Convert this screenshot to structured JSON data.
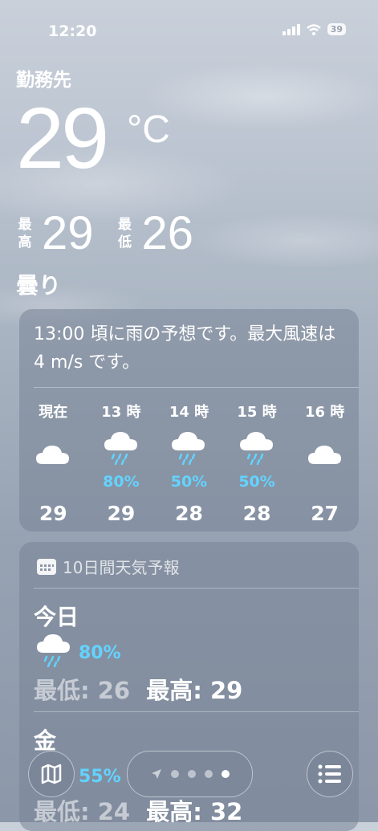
{
  "status": {
    "time": "12:20",
    "battery": "39"
  },
  "current": {
    "location": "勤務先",
    "temperature": "29",
    "unit": "°C",
    "high_label": "最高",
    "high": "29",
    "low_label": "最低",
    "low": "26",
    "condition": "曇り"
  },
  "hourly": {
    "summary": "13:00 頃に雨の予想です。最大風速は 4 m/s です。",
    "items": [
      {
        "label": "現在",
        "icon": "cloud-icon",
        "pop": "",
        "temp": "29"
      },
      {
        "label": "13 時",
        "icon": "rain-cloud-icon",
        "pop": "80%",
        "temp": "29"
      },
      {
        "label": "14 時",
        "icon": "rain-cloud-icon",
        "pop": "50%",
        "temp": "28"
      },
      {
        "label": "15 時",
        "icon": "rain-cloud-icon",
        "pop": "50%",
        "temp": "28"
      },
      {
        "label": "16 時",
        "icon": "cloud-icon",
        "pop": "",
        "temp": "27"
      }
    ]
  },
  "forecast": {
    "title": "10日間天気予報",
    "days": [
      {
        "name": "今日",
        "pop": "80%",
        "low_label": "最低:",
        "low": "26",
        "high_label": "最高:",
        "high": "29"
      },
      {
        "name": "金",
        "pop": "55%",
        "low_label": "最低:",
        "low": "24",
        "high_label": "最高:",
        "high": "32"
      }
    ]
  },
  "colors": {
    "precip": "#63d3ff"
  }
}
